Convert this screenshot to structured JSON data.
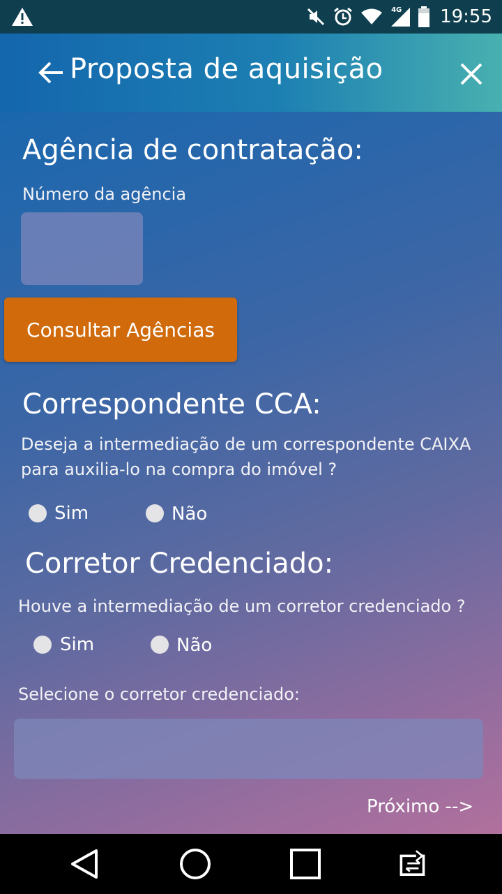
{
  "status_bar": {
    "time": "19:55",
    "network": "4G",
    "icons": [
      "warning-icon",
      "mute-icon",
      "alarm-icon",
      "wifi-icon",
      "signal-icon",
      "battery-icon"
    ]
  },
  "app_bar": {
    "title": "Proposta de aquisição",
    "back_icon": "arrow-left-icon",
    "close_icon": "close-icon"
  },
  "agencia": {
    "heading": "Agência de contratação:",
    "field_label": "Número da agência",
    "field_value": "",
    "consult_button": "Consultar Agências"
  },
  "cca": {
    "heading": "Correspondente CCA:",
    "question_line1": "Deseja a intermediação de um correspondente CAIXA",
    "question_line2": "para auxilia-lo na compra do imóvel ?",
    "options": [
      "Sim",
      "Não"
    ]
  },
  "corretor": {
    "heading": "Corretor Credenciado:",
    "question": "Houve a intermediação de um corretor credenciado ?",
    "options": [
      "Sim",
      "Não"
    ],
    "select_label": "Selecione o corretor credenciado:",
    "select_value": ""
  },
  "footer": {
    "next_label": "Próximo -->"
  },
  "nav_bar": {
    "icons": [
      "back-triangle-icon",
      "home-circle-icon",
      "recents-square-icon",
      "switch-app-icon"
    ]
  },
  "colors": {
    "status_bar": "#0f3f4e",
    "app_bar_start": "#1466ad",
    "app_bar_end": "#48b0b0",
    "accent_button": "#d06a0a",
    "nav_bar": "#000000"
  }
}
